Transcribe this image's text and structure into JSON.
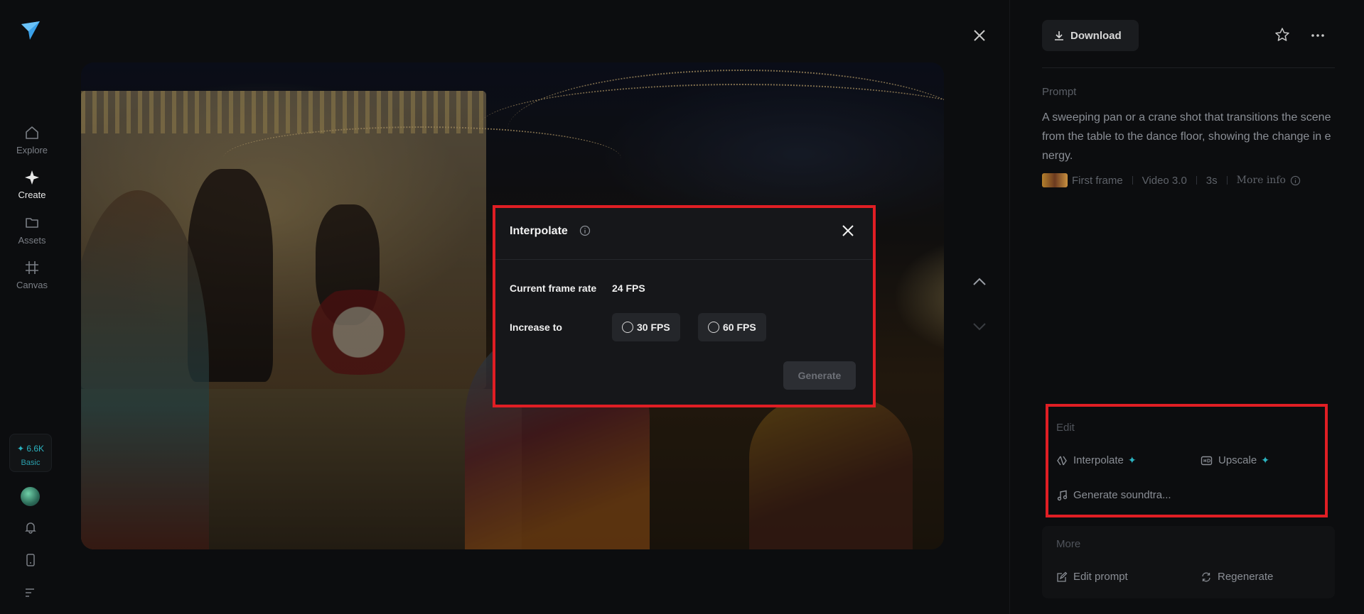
{
  "nav": {
    "items": [
      {
        "label": "Explore",
        "icon": "home-icon"
      },
      {
        "label": "Create",
        "icon": "sparkle-icon"
      },
      {
        "label": "Assets",
        "icon": "folder-icon"
      },
      {
        "label": "Canvas",
        "icon": "frame-icon"
      }
    ],
    "credits": {
      "amount": "✦ 6.6K",
      "plan": "Basic"
    }
  },
  "modal": {
    "title": "Interpolate",
    "current_label": "Current frame rate",
    "current_value": "24 FPS",
    "increase_label": "Increase to",
    "options": [
      "30 FPS",
      "60 FPS"
    ],
    "generate_label": "Generate"
  },
  "panel": {
    "download_label": "Download",
    "prompt_label": "Prompt",
    "prompt_text": "A sweeping pan or a crane shot that transitions the scene from the table to the dance floor, showing the change in energy.",
    "meta": {
      "first_frame": "First frame",
      "model": "Video 3.0",
      "duration": "3s",
      "more_info": "More info"
    },
    "edit": {
      "label": "Edit",
      "interpolate": "Interpolate",
      "upscale": "Upscale",
      "soundtrack": "Generate soundtra..."
    },
    "more": {
      "label": "More",
      "edit_prompt": "Edit prompt",
      "regenerate": "Regenerate"
    }
  },
  "colors": {
    "accent": "#2bb3c0",
    "highlight": "#e01e24"
  }
}
